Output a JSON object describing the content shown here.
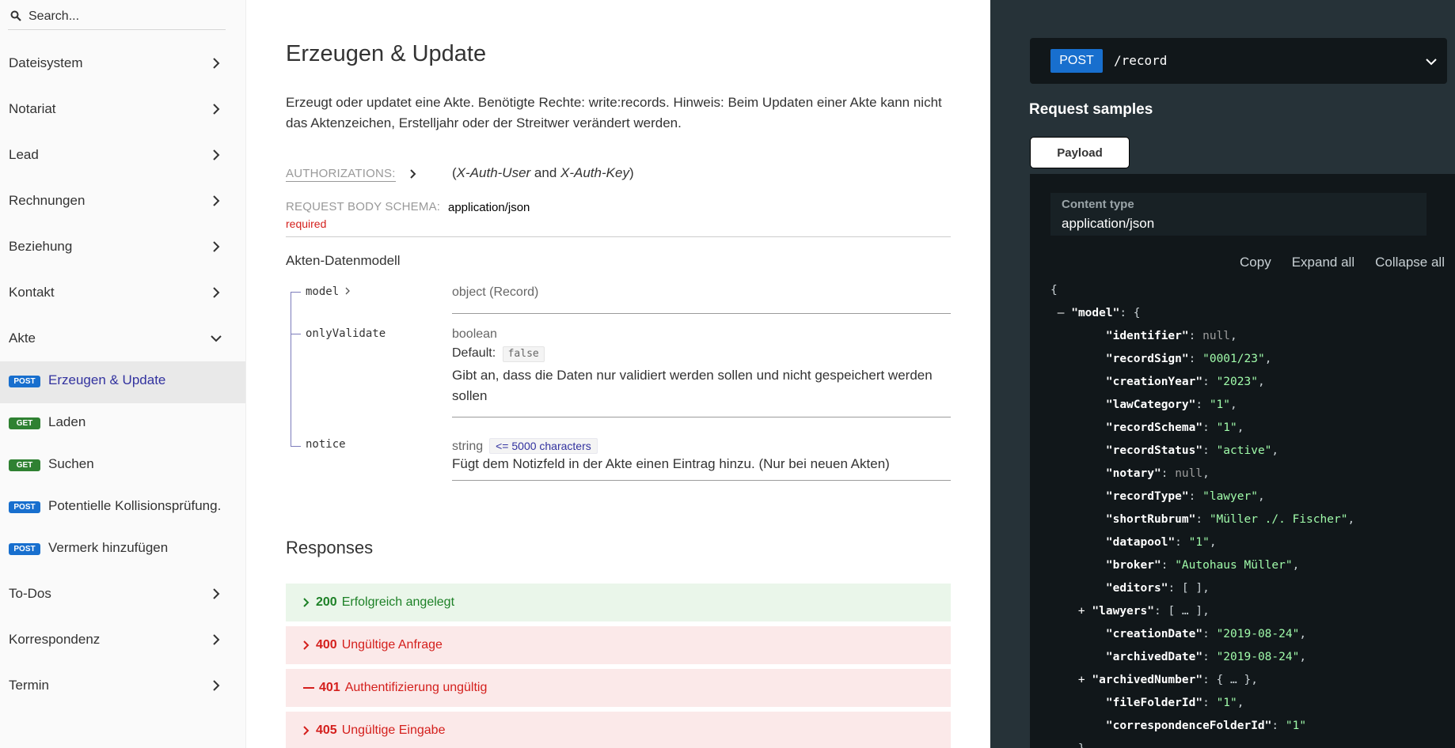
{
  "sidebar": {
    "search_placeholder": "Search...",
    "sections": [
      {
        "label": "Dateisystem"
      },
      {
        "label": "Notariat"
      },
      {
        "label": "Lead"
      },
      {
        "label": "Rechnungen"
      },
      {
        "label": "Beziehung"
      },
      {
        "label": "Kontakt"
      },
      {
        "label": "Akte"
      }
    ],
    "operations": [
      {
        "method": "POST",
        "label": "Erzeugen & Update"
      },
      {
        "method": "GET",
        "label": "Laden"
      },
      {
        "method": "GET",
        "label": "Suchen"
      },
      {
        "method": "POST",
        "label": "Potentielle Kollisionsprüfung."
      },
      {
        "method": "POST",
        "label": "Vermerk hinzufügen"
      }
    ],
    "sections_after": [
      {
        "label": "To-Dos"
      },
      {
        "label": "Korrespondenz"
      },
      {
        "label": "Termin"
      }
    ]
  },
  "main": {
    "title": "Erzeugen & Update",
    "description": "Erzeugt oder updatet eine Akte. Benötigte Rechte: write:records. Hinweis: Beim Updaten einer Akte kann nicht das Aktenzeichen, Erstelljahr oder der Streitwer verändert werden.",
    "auth_title": "AUTHORIZATIONS:",
    "auth_open": "(",
    "auth_user": "X-Auth-User",
    "auth_and": " and ",
    "auth_key": "X-Auth-Key",
    "auth_close": ")",
    "schema_title": "REQUEST BODY SCHEMA:",
    "schema_type": "application/json",
    "required": "required",
    "model_name": "Akten-Datenmodell",
    "props": [
      {
        "name": "model",
        "type": "object (Record)"
      },
      {
        "name": "onlyValidate",
        "type": "boolean",
        "default_label": "Default:",
        "default_value": "false",
        "description": "Gibt an, dass die Daten nur validiert werden sollen und nicht gespeichert werden sollen"
      },
      {
        "name": "notice",
        "type": "string",
        "constraint": "<= 5000 characters",
        "description": "Fügt dem Notizfeld in der Akte einen Eintrag hinzu. (Nur bei neuen Akten)"
      }
    ],
    "responses_title": "Responses",
    "responses": [
      {
        "code": "200",
        "text": "Erfolgreich angelegt",
        "toggle": "›"
      },
      {
        "code": "400",
        "text": "Ungültige Anfrage",
        "toggle": "›"
      },
      {
        "code": "401",
        "text": "Authentifizierung ungültig",
        "toggle": "—"
      },
      {
        "code": "405",
        "text": "Ungültige Eingabe",
        "toggle": "›"
      }
    ]
  },
  "panel": {
    "method": "POST",
    "path": "/record",
    "request_title": "Request samples",
    "tab": "Payload",
    "content_type_label": "Content type",
    "content_type": "application/json",
    "actions": [
      "Copy",
      "Expand all",
      "Collapse all"
    ],
    "json_lines": [
      {
        "indent": 0,
        "toggle": "",
        "key": "",
        "value": "{",
        "vtype": "t",
        "comma": ""
      },
      {
        "indent": 1,
        "toggle": "–",
        "key": "model",
        "value": "{",
        "vtype": "t",
        "comma": ""
      },
      {
        "indent": 3,
        "toggle": "",
        "key": "identifier",
        "value": "null",
        "vtype": "n",
        "comma": ","
      },
      {
        "indent": 3,
        "toggle": "",
        "key": "recordSign",
        "value": "\"0001/23\"",
        "vtype": "s",
        "comma": ","
      },
      {
        "indent": 3,
        "toggle": "",
        "key": "creationYear",
        "value": "\"2023\"",
        "vtype": "s",
        "comma": ","
      },
      {
        "indent": 3,
        "toggle": "",
        "key": "lawCategory",
        "value": "\"1\"",
        "vtype": "s",
        "comma": ","
      },
      {
        "indent": 3,
        "toggle": "",
        "key": "recordSchema",
        "value": "\"1\"",
        "vtype": "s",
        "comma": ","
      },
      {
        "indent": 3,
        "toggle": "",
        "key": "recordStatus",
        "value": "\"active\"",
        "vtype": "s",
        "comma": ","
      },
      {
        "indent": 3,
        "toggle": "",
        "key": "notary",
        "value": "null",
        "vtype": "n",
        "comma": ","
      },
      {
        "indent": 3,
        "toggle": "",
        "key": "recordType",
        "value": "\"lawyer\"",
        "vtype": "s",
        "comma": ","
      },
      {
        "indent": 3,
        "toggle": "",
        "key": "shortRubrum",
        "value": "\"Müller ./. Fischer\"",
        "vtype": "s",
        "comma": ","
      },
      {
        "indent": 3,
        "toggle": "",
        "key": "datapool",
        "value": "\"1\"",
        "vtype": "s",
        "comma": ","
      },
      {
        "indent": 3,
        "toggle": "",
        "key": "broker",
        "value": "\"Autohaus Müller\"",
        "vtype": "s",
        "comma": ","
      },
      {
        "indent": 3,
        "toggle": "",
        "key": "editors",
        "value": "[ ]",
        "vtype": "t",
        "comma": ","
      },
      {
        "indent": 2,
        "toggle": "+",
        "key": "lawyers",
        "value": "[ … ]",
        "vtype": "t",
        "comma": ","
      },
      {
        "indent": 3,
        "toggle": "",
        "key": "creationDate",
        "value": "\"2019-08-24\"",
        "vtype": "s",
        "comma": ","
      },
      {
        "indent": 3,
        "toggle": "",
        "key": "archivedDate",
        "value": "\"2019-08-24\"",
        "vtype": "s",
        "comma": ","
      },
      {
        "indent": 2,
        "toggle": "+",
        "key": "archivedNumber",
        "value": "{ … }",
        "vtype": "t",
        "comma": ","
      },
      {
        "indent": 3,
        "toggle": "",
        "key": "fileFolderId",
        "value": "\"1\"",
        "vtype": "s",
        "comma": ","
      },
      {
        "indent": 3,
        "toggle": "",
        "key": "correspondenceFolderId",
        "value": "\"1\"",
        "vtype": "s",
        "comma": ""
      },
      {
        "indent": 2,
        "toggle": "",
        "key": "",
        "value": "},",
        "vtype": "t",
        "comma": ""
      }
    ]
  },
  "colors": {
    "post": "#186fce",
    "get": "#2f8132",
    "panel_bg": "#263238",
    "json_string": "#a0fbaa",
    "active_link": "#32329f",
    "success": "#1d8127",
    "error": "#d41f1c"
  },
  "icons": {
    "search": "search-icon",
    "chevron_right": "chevron-right-icon",
    "chevron_down": "chevron-down-icon"
  }
}
